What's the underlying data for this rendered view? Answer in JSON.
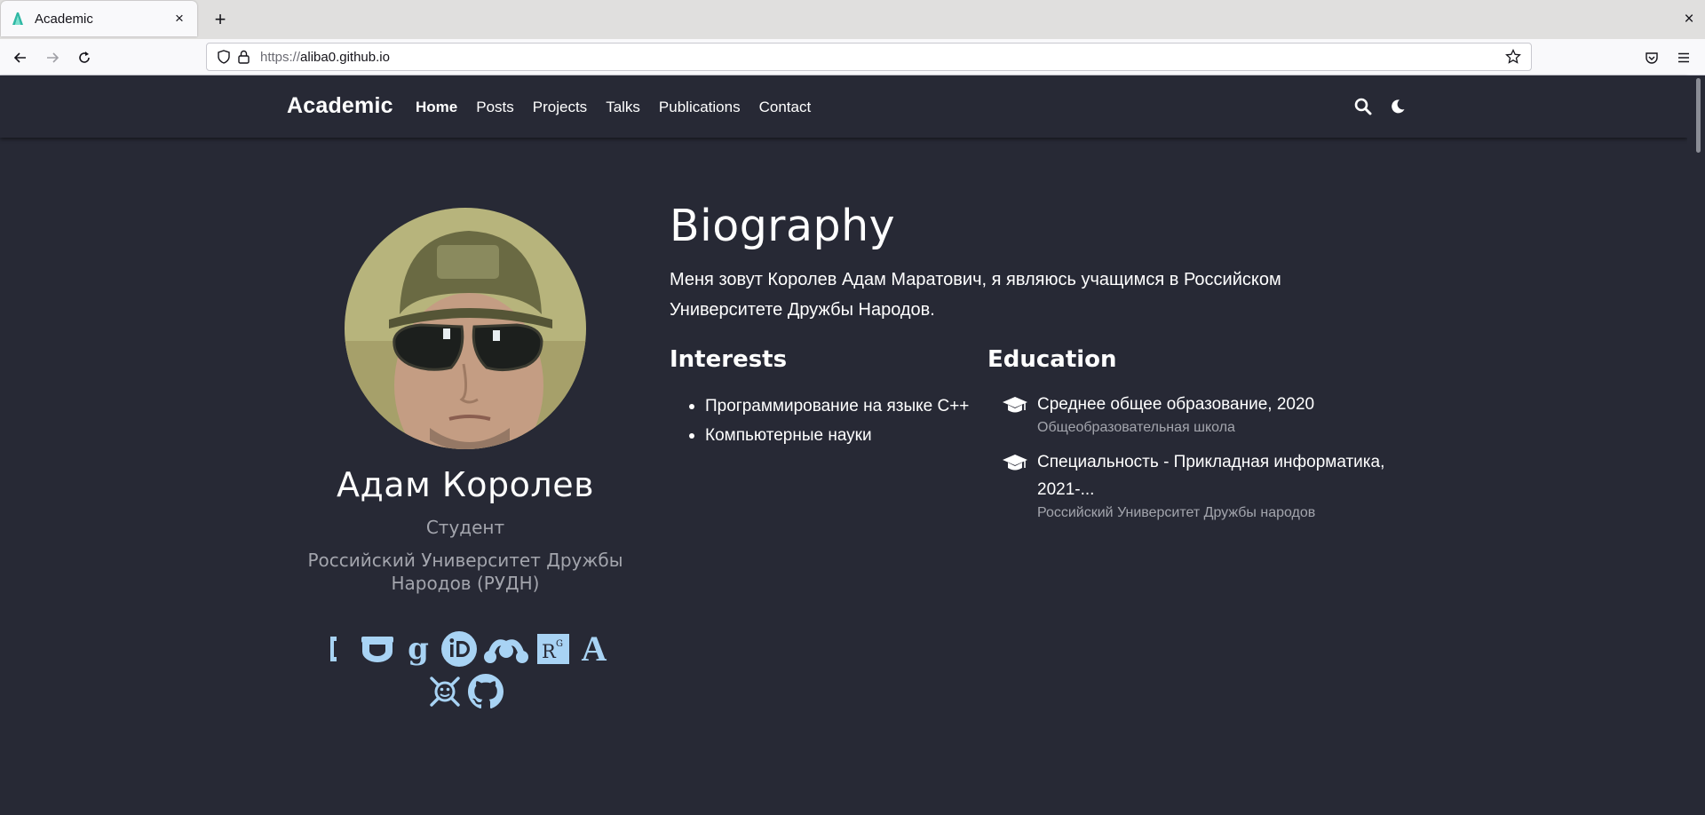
{
  "browser": {
    "tab_title": "Academic",
    "tab_close": "×",
    "new_tab": "+",
    "window_close": "×",
    "url_protocol": "https://",
    "url_host": "aliba0.github.io"
  },
  "site": {
    "brand": "Academic",
    "menu": [
      {
        "label": "Home",
        "active": true
      },
      {
        "label": "Posts"
      },
      {
        "label": "Projects"
      },
      {
        "label": "Talks"
      },
      {
        "label": "Publications"
      },
      {
        "label": "Contact"
      }
    ],
    "icons": [
      "search-icon",
      "moon-icon"
    ]
  },
  "profile": {
    "name": "Адам Королев",
    "role": "Студент",
    "organization": "Российский Университет Дружбы Народов (РУДН)",
    "social_icons": [
      "email-icon",
      "twitter-icon",
      "google-scholar-icon",
      "orcid-icon",
      "mendeley-icon",
      "researchgate-icon",
      "academia-icon",
      "hacker-icon",
      "github-icon"
    ],
    "accent_color": "#a8d3f4"
  },
  "biography": {
    "title": "Biography",
    "text": "Меня зовут Королев Адам Маратович, я являюсь учащимся в Российском Университете Дружбы Народов."
  },
  "interests": {
    "title": "Interests",
    "items": [
      "Программирование на языке C++",
      "Компьютерные науки"
    ]
  },
  "education": {
    "title": "Education",
    "items": [
      {
        "degree": "Среднее общее образование, 2020",
        "institution": "Общеобразовательная школа"
      },
      {
        "degree": "Специальность - Прикладная информатика, 2021-...",
        "institution": "Российский Университет Дружбы народов"
      }
    ]
  },
  "colors": {
    "page_background": "#272935",
    "text": "#ffffff",
    "muted_text": "#a3a5ad"
  }
}
